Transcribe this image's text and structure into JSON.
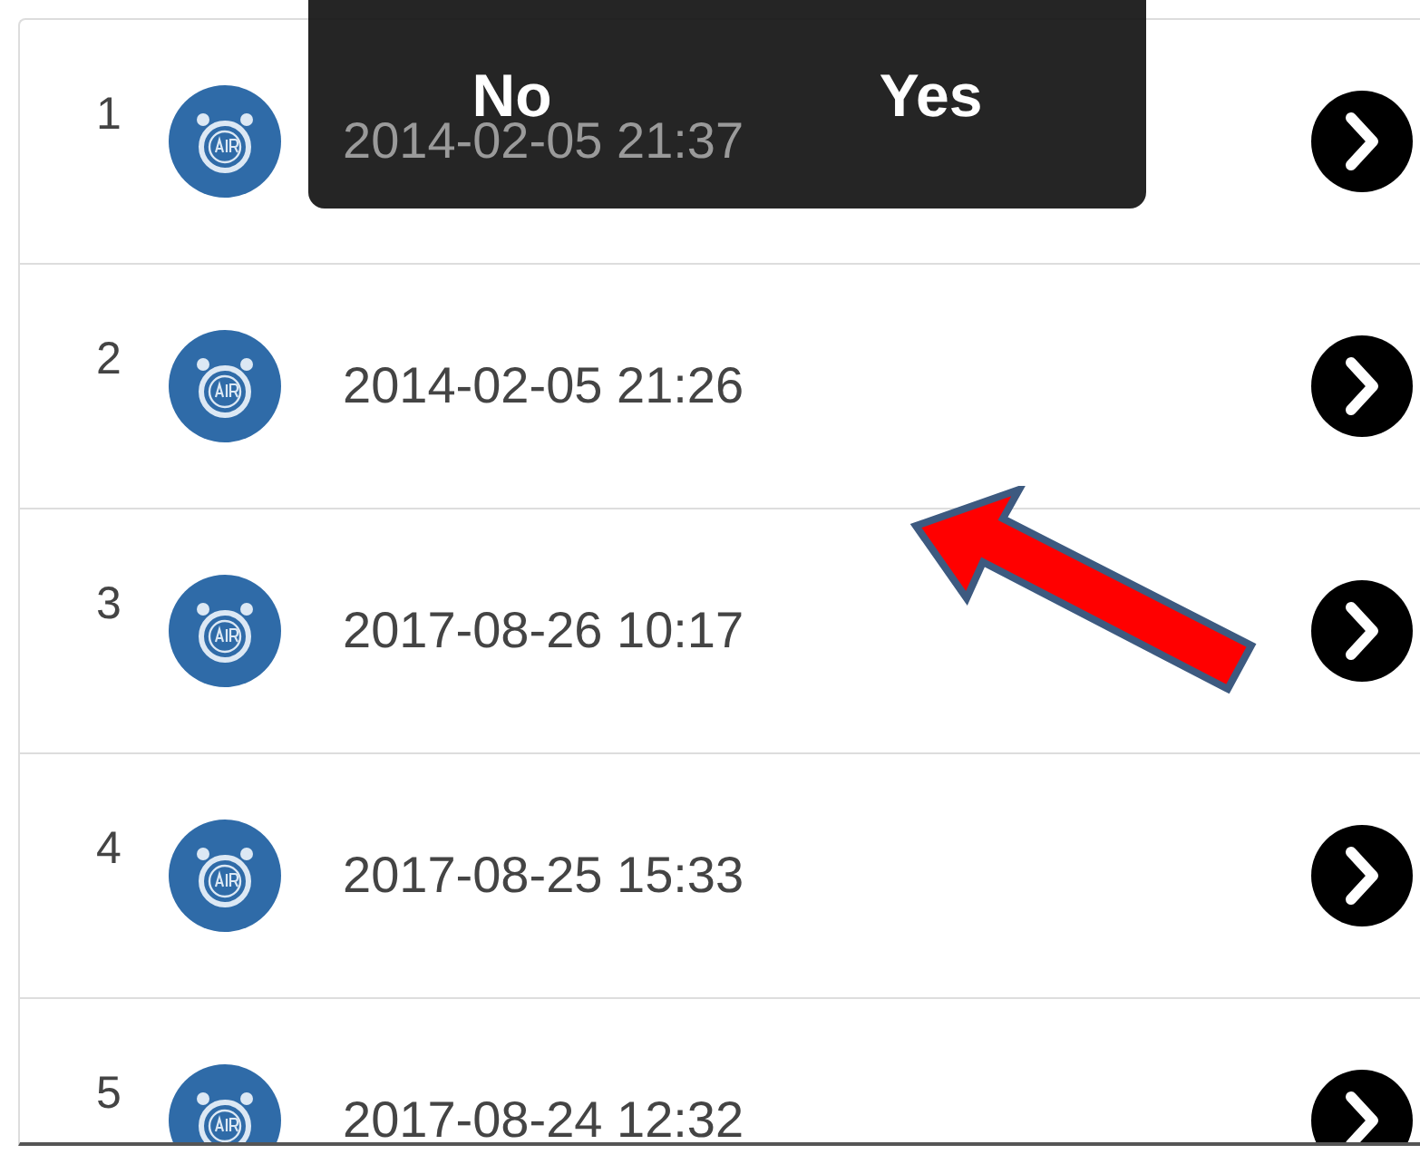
{
  "dialog": {
    "buttons": [
      {
        "label": "No"
      },
      {
        "label": "Yes"
      }
    ]
  },
  "records": [
    {
      "index": "1",
      "time": "2014-02-05 21:37"
    },
    {
      "index": "2",
      "time": "2014-02-05 21:26"
    },
    {
      "index": "3",
      "time": "2017-08-26 10:17"
    },
    {
      "index": "4",
      "time": "2017-08-25 15:33"
    },
    {
      "index": "5",
      "time": "2017-08-24 12:32"
    }
  ]
}
